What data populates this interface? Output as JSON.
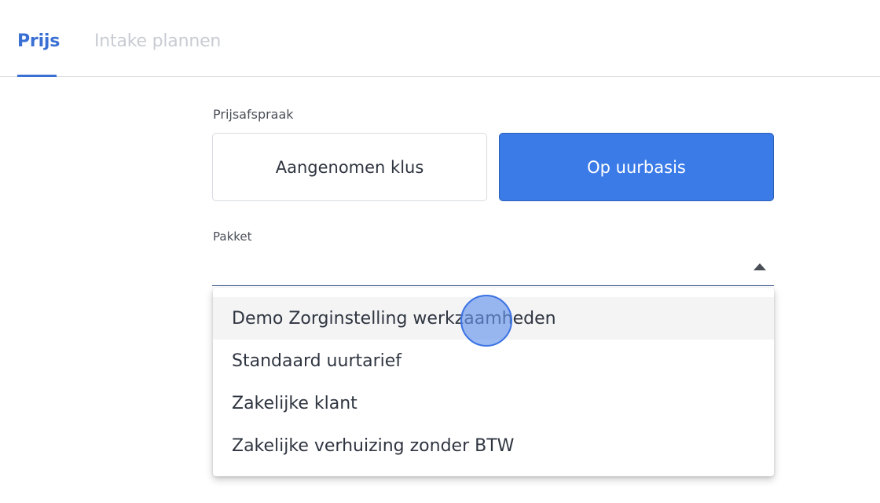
{
  "tabs": {
    "active_label": "Prijs",
    "inactive_label": "Intake plannen"
  },
  "form": {
    "price_label": "Prijsafspraak",
    "price_options": [
      "Aangenomen klus",
      "Op uurbasis"
    ],
    "selected_price_option": "Op uurbasis",
    "package_label": "Pakket",
    "package_value": ""
  },
  "dropdown": {
    "items": [
      "Demo Zorginstelling werkzaamheden",
      "Standaard uurtarief",
      "Zakelijke klant",
      "Zakelijke verhuizing zonder BTW"
    ]
  },
  "colors": {
    "accent": "#3a6fd4",
    "selected_button": "#3b7be8",
    "cursor_highlight": "#6694eb"
  }
}
